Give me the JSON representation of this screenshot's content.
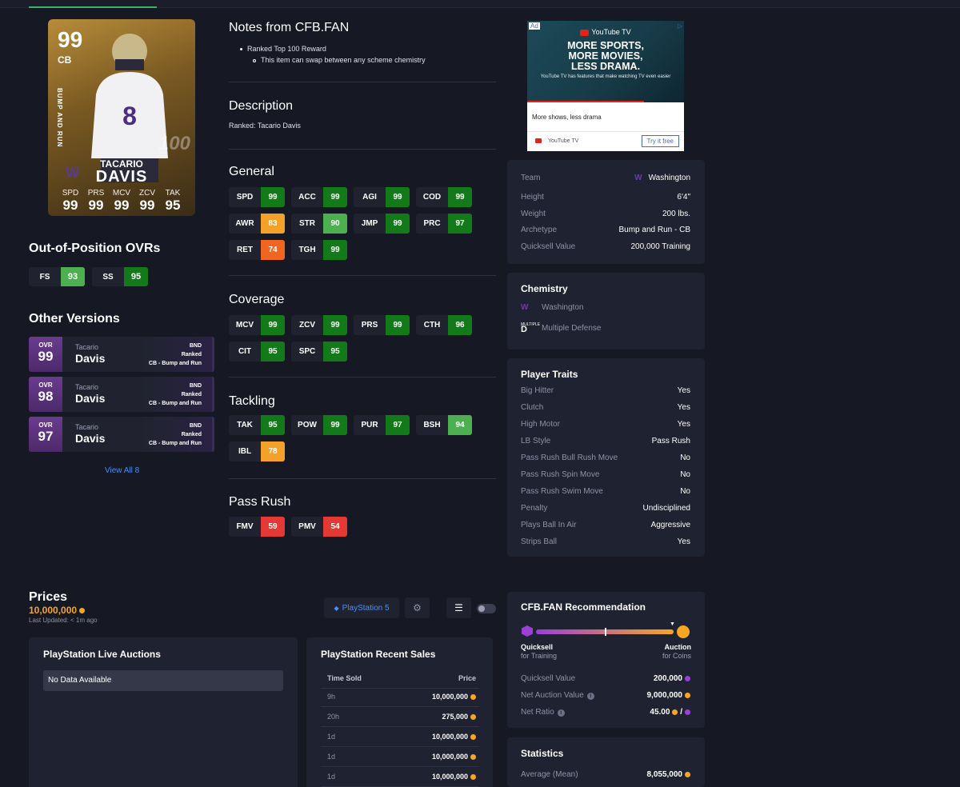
{
  "card": {
    "ovr": "99",
    "pos": "CB",
    "archetype": "BUMP AND RUN",
    "rank": "100",
    "first": "TACARIO",
    "last": "DAVIS",
    "stats": [
      {
        "l": "SPD",
        "v": "99"
      },
      {
        "l": "PRS",
        "v": "99"
      },
      {
        "l": "MCV",
        "v": "99"
      },
      {
        "l": "ZCV",
        "v": "99"
      },
      {
        "l": "TAK",
        "v": "95"
      }
    ]
  },
  "oop_title": "Out-of-Position OVRs",
  "oop": [
    {
      "label": "FS",
      "value": "93",
      "color": "#4caf50"
    },
    {
      "label": "SS",
      "value": "95",
      "color": "#137a1a"
    }
  ],
  "other_title": "Other Versions",
  "versions": [
    {
      "ovr_label": "OVR",
      "ovr": "99",
      "first": "Tacario",
      "last": "Davis",
      "team": "BND",
      "program": "Ranked",
      "arche": "CB - Bump and Run"
    },
    {
      "ovr_label": "OVR",
      "ovr": "98",
      "first": "Tacario",
      "last": "Davis",
      "team": "BND",
      "program": "Ranked",
      "arche": "CB - Bump and Run"
    },
    {
      "ovr_label": "OVR",
      "ovr": "97",
      "first": "Tacario",
      "last": "Davis",
      "team": "BND",
      "program": "Ranked",
      "arche": "CB - Bump and Run"
    }
  ],
  "view_all": "View All 8",
  "notes_title": "Notes from CFB.FAN",
  "notes": [
    "Ranked Top 100 Reward",
    "This item can swap between any scheme chemistry"
  ],
  "desc_title": "Description",
  "desc": "Ranked: Tacario Davis",
  "groups": {
    "general": {
      "title": "General",
      "attrs": [
        {
          "k": "SPD",
          "v": "99",
          "c": "#137a1a"
        },
        {
          "k": "ACC",
          "v": "99",
          "c": "#137a1a"
        },
        {
          "k": "AGI",
          "v": "99",
          "c": "#137a1a"
        },
        {
          "k": "COD",
          "v": "99",
          "c": "#137a1a"
        },
        {
          "k": "AWR",
          "v": "83",
          "c": "#f4a12a"
        },
        {
          "k": "STR",
          "v": "90",
          "c": "#4caf50"
        },
        {
          "k": "JMP",
          "v": "99",
          "c": "#137a1a"
        },
        {
          "k": "PRC",
          "v": "97",
          "c": "#137a1a"
        },
        {
          "k": "RET",
          "v": "74",
          "c": "#f0651f"
        },
        {
          "k": "TGH",
          "v": "99",
          "c": "#137a1a"
        }
      ]
    },
    "coverage": {
      "title": "Coverage",
      "attrs": [
        {
          "k": "MCV",
          "v": "99",
          "c": "#137a1a"
        },
        {
          "k": "ZCV",
          "v": "99",
          "c": "#137a1a"
        },
        {
          "k": "PRS",
          "v": "99",
          "c": "#137a1a"
        },
        {
          "k": "CTH",
          "v": "96",
          "c": "#137a1a"
        },
        {
          "k": "CIT",
          "v": "95",
          "c": "#137a1a"
        },
        {
          "k": "SPC",
          "v": "95",
          "c": "#137a1a"
        }
      ]
    },
    "tackling": {
      "title": "Tackling",
      "attrs": [
        {
          "k": "TAK",
          "v": "95",
          "c": "#137a1a"
        },
        {
          "k": "POW",
          "v": "99",
          "c": "#137a1a"
        },
        {
          "k": "PUR",
          "v": "97",
          "c": "#137a1a"
        },
        {
          "k": "BSH",
          "v": "94",
          "c": "#4caf50"
        },
        {
          "k": "IBL",
          "v": "78",
          "c": "#f4a12a"
        }
      ]
    },
    "passrush": {
      "title": "Pass Rush",
      "attrs": [
        {
          "k": "FMV",
          "v": "59",
          "c": "#e53935"
        },
        {
          "k": "PMV",
          "v": "54",
          "c": "#e53935"
        }
      ]
    }
  },
  "ad": {
    "tag": "Ad",
    "brand": "YouTube TV",
    "headline": [
      "MORE SPORTS,",
      "MORE MOVIES,",
      "LESS DRAMA."
    ],
    "sub": "YouTube TV has features that make watching TV even easier",
    "caption": "More shows, less drama",
    "cta": "Try it free"
  },
  "info": [
    {
      "l": "Team",
      "r": "Washington"
    },
    {
      "l": "Height",
      "r": "6'4\""
    },
    {
      "l": "Weight",
      "r": "200 lbs."
    },
    {
      "l": "Archetype",
      "r": "Bump and Run - CB"
    },
    {
      "l": "Quicksell Value",
      "r": "200,000 Training"
    }
  ],
  "chem_title": "Chemistry",
  "chem": [
    "Washington",
    "Multiple Defense"
  ],
  "chem_logo_text": "MULTIPLE",
  "traits_title": "Player Traits",
  "traits": [
    {
      "l": "Big Hitter",
      "r": "Yes"
    },
    {
      "l": "Clutch",
      "r": "Yes"
    },
    {
      "l": "High Motor",
      "r": "Yes"
    },
    {
      "l": "LB Style",
      "r": "Pass Rush"
    },
    {
      "l": "Pass Rush Bull Rush Move",
      "r": "No"
    },
    {
      "l": "Pass Rush Spin Move",
      "r": "No"
    },
    {
      "l": "Pass Rush Swim Move",
      "r": "No"
    },
    {
      "l": "Penalty",
      "r": "Undisciplined"
    },
    {
      "l": "Plays Ball In Air",
      "r": "Aggressive"
    },
    {
      "l": "Strips Ball",
      "r": "Yes"
    }
  ],
  "prices": {
    "title": "Prices",
    "value": "10,000,000",
    "updated": "Last Updated: < 1m ago",
    "platform": "PlayStation 5"
  },
  "live": {
    "title": "PlayStation Live Auctions",
    "empty": "No Data Available"
  },
  "recent": {
    "title": "PlayStation Recent Sales",
    "col1": "Time Sold",
    "col2": "Price",
    "rows": [
      {
        "t": "9h",
        "p": "10,000,000"
      },
      {
        "t": "20h",
        "p": "275,000"
      },
      {
        "t": "1d",
        "p": "10,000,000"
      },
      {
        "t": "1d",
        "p": "10,000,000"
      },
      {
        "t": "1d",
        "p": "10,000,000"
      }
    ]
  },
  "rec": {
    "title": "CFB.FAN Recommendation",
    "left1": "Quicksell",
    "left2": "for Training",
    "right1": "Auction",
    "right2": "for Coins",
    "qs_label": "Quicksell Value",
    "qs": "200,000",
    "na_label": "Net Auction Value",
    "na": "9,000,000",
    "nr_label": "Net Ratio",
    "nr": "45.00",
    "nr_sep": "/"
  },
  "stats": {
    "title": "Statistics",
    "avg_label": "Average (Mean)",
    "avg": "8,055,000"
  },
  "colors": {
    "bg": "#161824",
    "panel": "#1f2230",
    "accent": "#4d8ff1",
    "coin": "#f5a623",
    "gem": "#9b3fd8"
  }
}
